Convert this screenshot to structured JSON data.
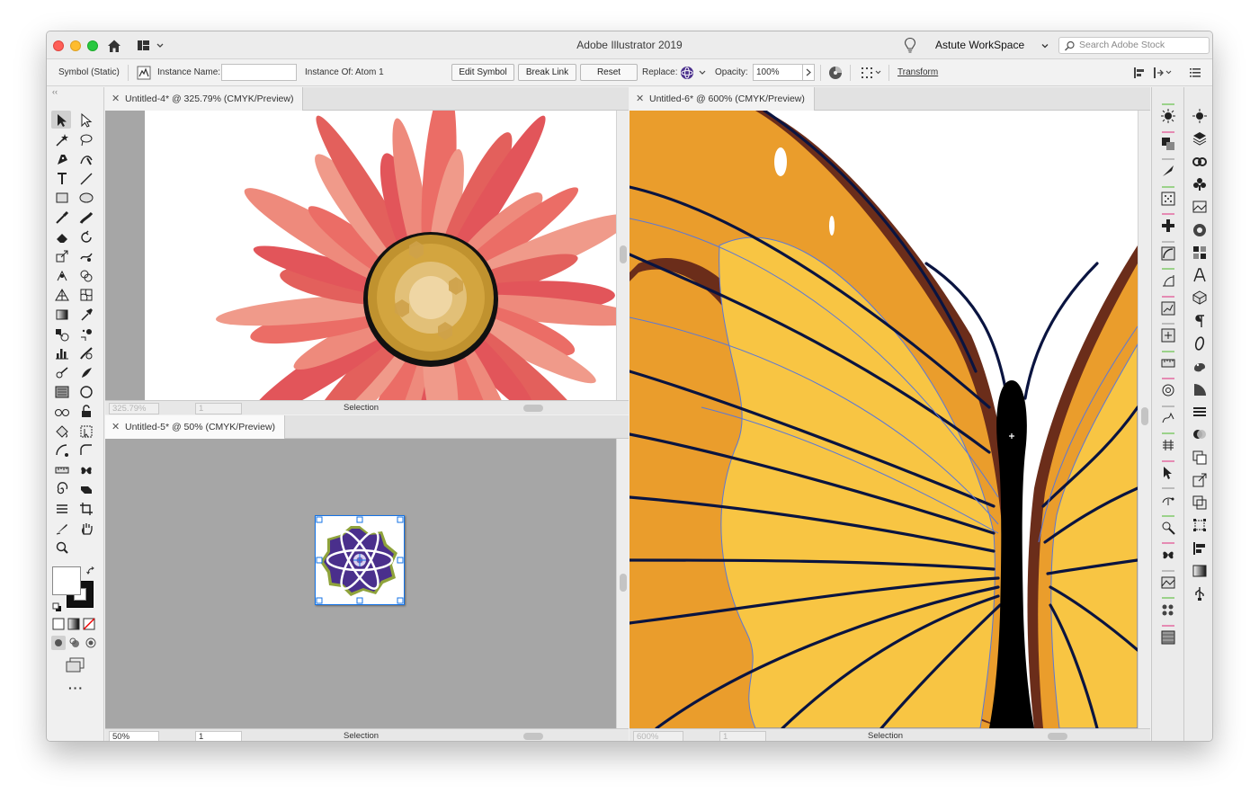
{
  "app": {
    "title": "Adobe Illustrator 2019",
    "workspace": "Astute WorkSpace",
    "search_placeholder": "Search Adobe Stock"
  },
  "control_bar": {
    "selection_type": "Symbol (Static)",
    "instance_name_label": "Instance Name:",
    "instance_name_value": "",
    "instance_of_label": "Instance Of:",
    "instance_of_value": "Atom 1",
    "edit_symbol": "Edit Symbol",
    "break_link": "Break Link",
    "reset": "Reset",
    "replace_label": "Replace:",
    "opacity_label": "Opacity:",
    "opacity_value": "100%",
    "transform": "Transform"
  },
  "documents": [
    {
      "tab": "Untitled-4* @ 325.79% (CMYK/Preview)",
      "zoom": "325.79%",
      "page": "1",
      "mode": "Selection",
      "active": false
    },
    {
      "tab": "Untitled-5* @ 50% (CMYK/Preview)",
      "zoom": "50%",
      "page": "1",
      "mode": "Selection",
      "active": true
    },
    {
      "tab": "Untitled-6* @ 600% (CMYK/Preview)",
      "zoom": "600%",
      "page": "1",
      "mode": "Selection",
      "active": false
    }
  ],
  "tools": [
    "selection-tool",
    "direct-selection-tool",
    "magic-wand-tool",
    "lasso-tool",
    "pen-tool",
    "curvature-tool",
    "type-tool",
    "line-segment-tool",
    "rectangle-tool",
    "ellipse-tool",
    "paintbrush-tool",
    "blob-brush-tool",
    "eraser-tool",
    "rotate-tool",
    "scale-tool",
    "warp-tool",
    "puppet-warp-tool",
    "shape-builder-tool",
    "perspective-grid-tool",
    "mesh-tool",
    "gradient-tool",
    "eyedropper-tool",
    "blend-tool",
    "symbol-sprayer-tool",
    "column-graph-tool",
    "symbol-shifter-tool",
    "dynamic-sketch-tool",
    "smart-remove-brush-tool",
    "texture-tool",
    "circle-tool",
    "glasses-tool",
    "lock-tool",
    "paint-bucket-tool",
    "live-paint-selection-tool",
    "arc-tool",
    "arc-corner-tool",
    "ruler-tool",
    "butterfly-tool",
    "spiral-tool",
    "3d-extrude-tool",
    "stack-tool",
    "crop-tool",
    "knife-tool",
    "hand-tool",
    "zoom-tool"
  ],
  "colors": {
    "accent_select": "#1473e6",
    "petal_dark": "#e2555a",
    "petal_light": "#ee8a7c",
    "center_gold": "#c89a3a",
    "wing_yellow": "#f8c543",
    "wing_orange": "#ea9d2c",
    "wing_brown": "#6b2d1a",
    "atom_purple": "#4a2f8c"
  }
}
